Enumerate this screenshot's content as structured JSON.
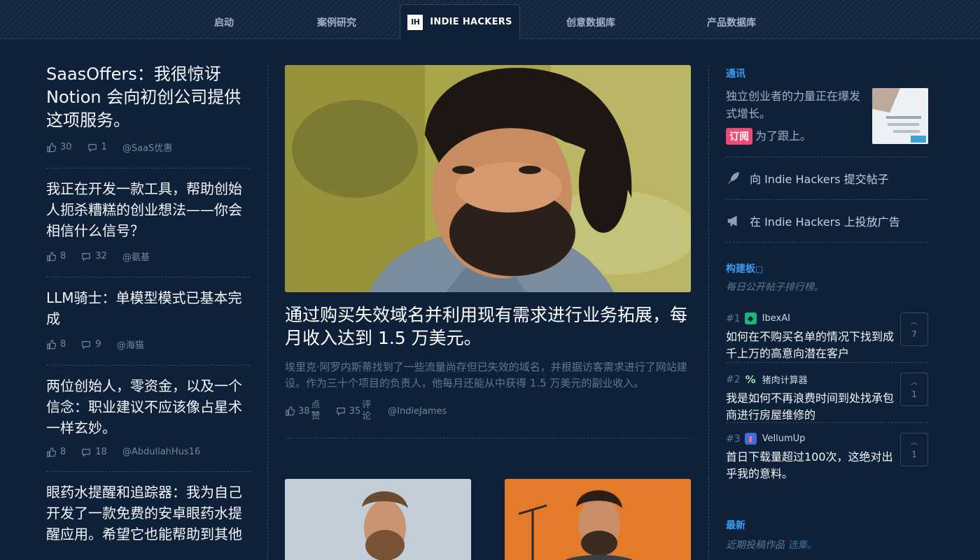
{
  "nav": {
    "items": [
      "启动",
      "案例研究",
      "创意数据库",
      "产品数据库"
    ],
    "active_logo": "IH",
    "active_label": "INDIE HACKERS"
  },
  "left_posts": [
    {
      "title": "SaasOffers：我很惊讶 Notion 会向初创公司提供这项服务。",
      "likes": "30",
      "comments": "1",
      "author": "@SaaS优惠"
    },
    {
      "title": "我正在开发一款工具，帮助创始人扼杀糟糕的创业想法——你会相信什么信号？",
      "likes": "8",
      "comments": "32",
      "author": "@氨基"
    },
    {
      "title": "LLM骑士：单模型模式已基本完成",
      "likes": "8",
      "comments": "9",
      "author": "@海猫"
    },
    {
      "title": "两位创始人，零资金，以及一个信念：职业建议不应该像占星术一样玄妙。",
      "likes": "8",
      "comments": "18",
      "author": "@AbdullahHus16"
    },
    {
      "title": "眼药水提醒和追踪器：我为自己开发了一款免费的安卓眼药水提醒应用。希望它也能帮助到其他人。"
    }
  ],
  "feature": {
    "title": "通过购买失效域名并利用现有需求进行业务拓展，每月收入达到 1.5 万美元。",
    "description": "埃里克·阿罗内斯蒂找到了一些流量尚存但已失效的域名，并根据访客需求进行了网站建设。作为三十个项目的负责人，他每月还能从中获得 1.5 万美元的副业收入。",
    "likes": "38",
    "likes_label_1": "点",
    "likes_label_2": "赞",
    "comments": "35",
    "comments_label_1": "评",
    "comments_label_2": "论",
    "author": "@IndieJames"
  },
  "sidebar": {
    "news_title": "通讯",
    "news_text": "独立创业者的力量正在爆发式增长。",
    "subscribe_label": "订阅",
    "subscribe_suffix": "为了跟上。",
    "submit_link": "向 Indie Hackers 提交帖子",
    "advertise_link": "在 Indie Hackers 上投放广告",
    "board_title": "构建板",
    "board_subtitle": "每日公开帖子排行榜。",
    "ranks": [
      {
        "num": "#1",
        "product": "IbexAI",
        "title": "如何在不购买名单的情况下找到成千上万的高意向潜在客户",
        "votes": "7",
        "logo_color": "#1fb57a",
        "logo_glyph": "◆"
      },
      {
        "num": "#2",
        "product": "猪肉计算器",
        "title": "我是如何不再浪费时间到处找承包商进行房屋维修的",
        "votes": "1",
        "logo_color": "#0f2139",
        "logo_glyph": "%"
      },
      {
        "num": "#3",
        "product": "VellumUp",
        "title": "首日下载量超过100次，这绝对出乎我的意料。",
        "votes": "1",
        "logo_color": "#3a6fe0",
        "logo_glyph": "▮"
      }
    ],
    "latest_title": "最新",
    "latest_text": "近期投稿作品",
    "latest_link": "选集。"
  }
}
